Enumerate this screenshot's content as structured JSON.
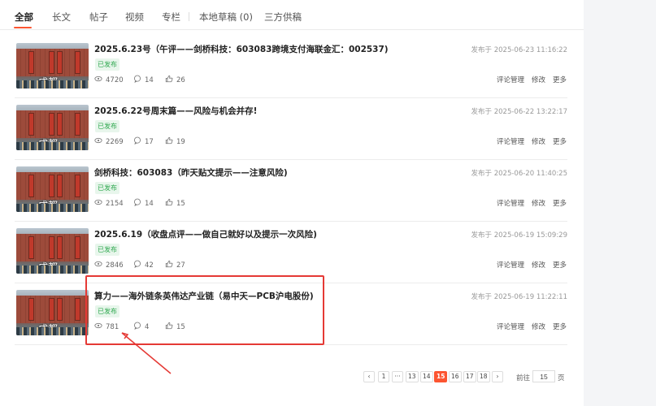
{
  "tabs": [
    "全部",
    "长文",
    "帖子",
    "视频",
    "专栏",
    "本地草稿 (0)",
    "三方供稿"
  ],
  "thumbnail_sign": "成都",
  "articles": [
    {
      "title": "2025.6.23号（午评——剑桥科技：603083跨境支付海联金汇：002537)",
      "status": "已发布",
      "date": "发布于 2025-06-23 11:16:22",
      "views": "4720",
      "comments": "14",
      "likes": "26"
    },
    {
      "title": "2025.6.22号周末篇——风险与机会并存!",
      "status": "已发布",
      "date": "发布于 2025-06-22 13:22:17",
      "views": "2269",
      "comments": "17",
      "likes": "19"
    },
    {
      "title": "剑桥科技：603083（昨天贴文提示——注意风险)",
      "status": "已发布",
      "date": "发布于 2025-06-20 11:40:25",
      "views": "2154",
      "comments": "14",
      "likes": "15"
    },
    {
      "title": "2025.6.19（收盘点评——做自己就好以及提示一次风险)",
      "status": "已发布",
      "date": "发布于 2025-06-19 15:09:29",
      "views": "2846",
      "comments": "42",
      "likes": "27"
    },
    {
      "title": "算力——海外链条英伟达产业链（易中天—PCB沪电股份)",
      "status": "已发布",
      "date": "发布于 2025-06-19 11:22:11",
      "views": "781",
      "comments": "4",
      "likes": "15"
    }
  ],
  "actions": {
    "comments": "评论管理",
    "edit": "修改",
    "more": "更多"
  },
  "pagination": {
    "prev": "‹",
    "next": "›",
    "pages": [
      "1",
      "···",
      "13",
      "14",
      "15",
      "16",
      "17",
      "18"
    ],
    "current": "15",
    "goto_label": "前往",
    "goto_value": "15",
    "page_unit": "页"
  },
  "colors": {
    "accent": "#fc5531",
    "published": "#2fa84f",
    "highlight": "#e53935"
  }
}
